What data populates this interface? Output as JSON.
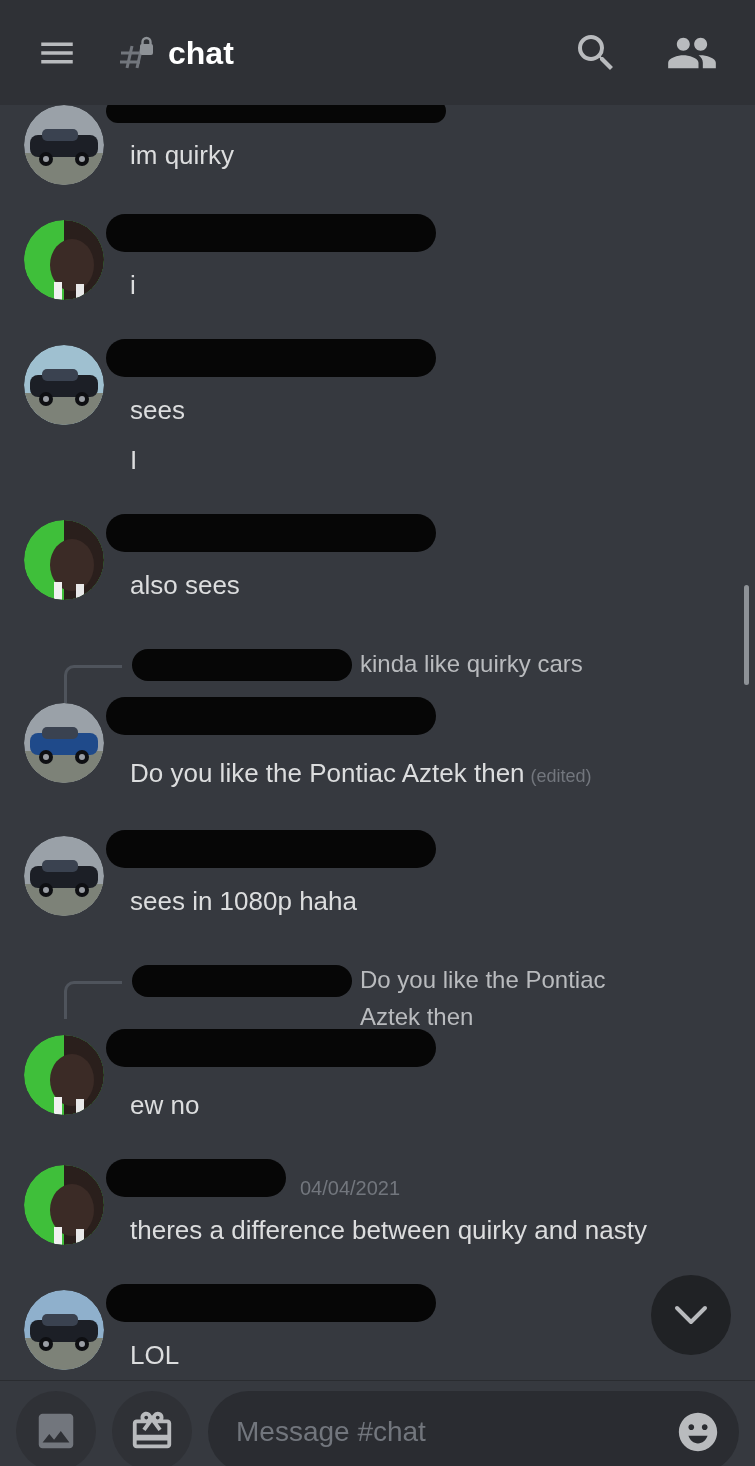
{
  "channel": {
    "name": "chat"
  },
  "messages": [
    {
      "kind": "plain",
      "lines": [
        "im quirky"
      ]
    },
    {
      "kind": "plain",
      "lines": [
        "i"
      ]
    },
    {
      "kind": "plain",
      "lines": [
        "sees",
        "I"
      ]
    },
    {
      "kind": "plain",
      "lines": [
        "also sees"
      ]
    },
    {
      "kind": "reply",
      "reply_text": "kinda like quirky cars",
      "lines": [
        "Do you like the Pontiac Aztek then"
      ],
      "edited_label": "(edited)"
    },
    {
      "kind": "plain",
      "lines": [
        "sees in 1080p haha"
      ]
    },
    {
      "kind": "reply",
      "reply_text": "Do you like the Pontiac Aztek then",
      "lines": [
        "ew no"
      ]
    },
    {
      "kind": "plain",
      "timestamp": "04/04/2021",
      "lines": [
        "theres a difference between quirky and nasty"
      ]
    },
    {
      "kind": "plain",
      "lines": [
        "LOL"
      ]
    }
  ],
  "composer": {
    "placeholder": "Message #chat"
  }
}
